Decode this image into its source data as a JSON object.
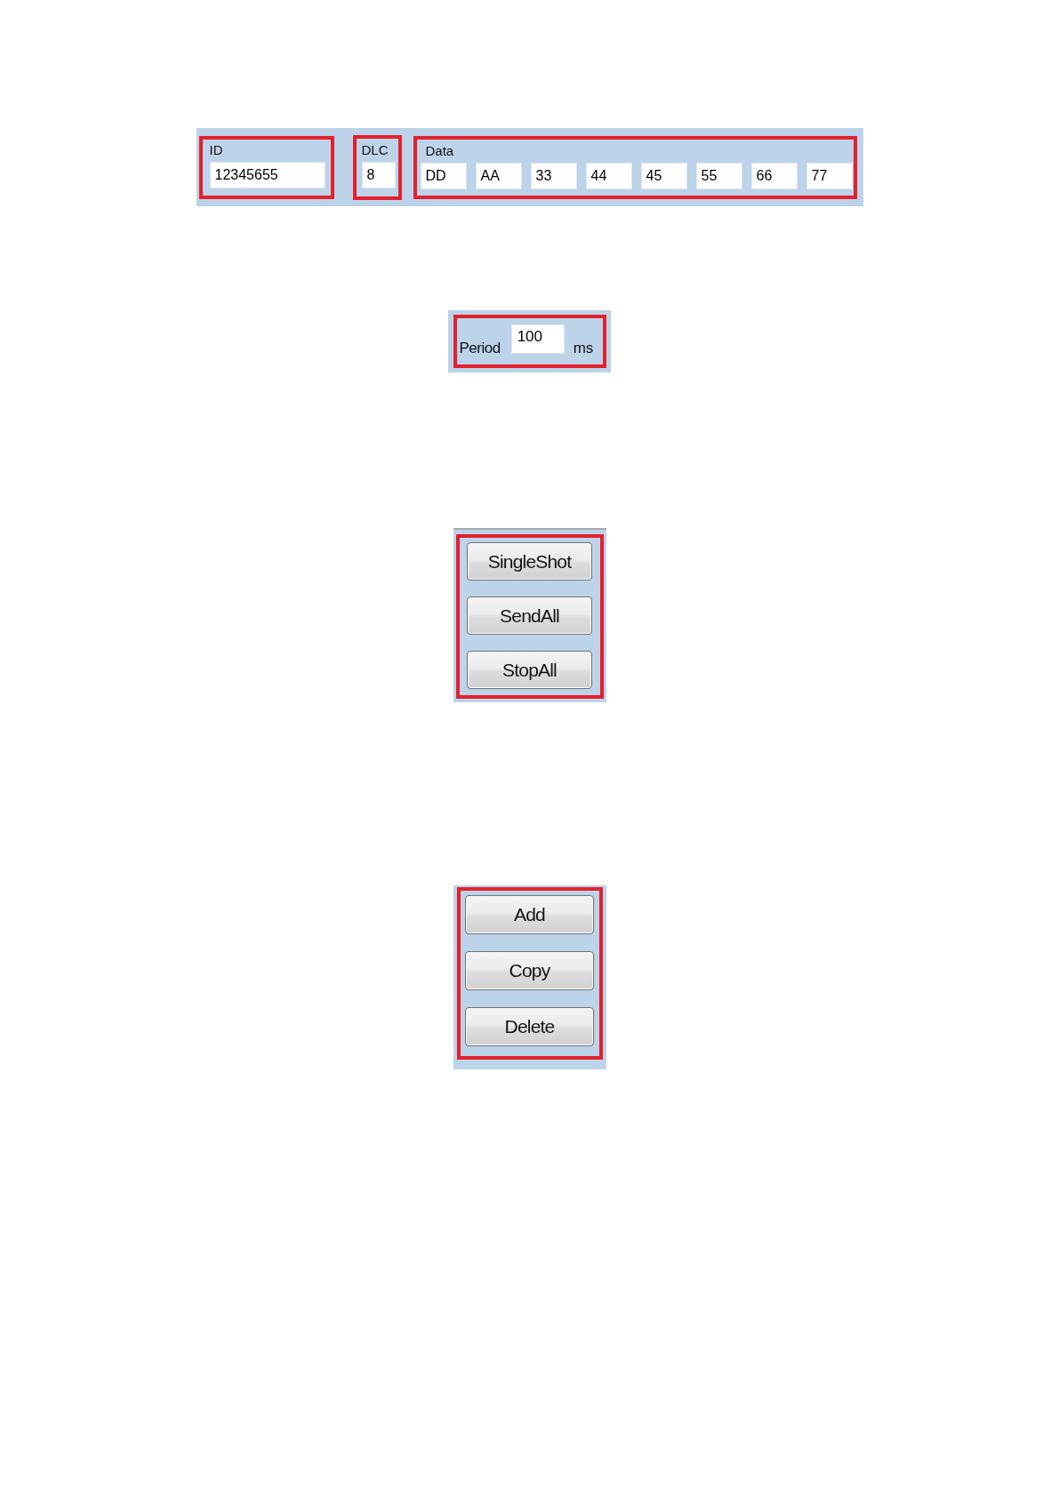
{
  "message": {
    "id": {
      "label": "ID",
      "value": "12345655"
    },
    "dlc": {
      "label": "DLC",
      "value": "8"
    },
    "data": {
      "label": "Data",
      "bytes": [
        "DD",
        "AA",
        "33",
        "44",
        "45",
        "55",
        "66",
        "77"
      ]
    }
  },
  "period": {
    "label": "Period",
    "value": "100",
    "unit": "ms"
  },
  "send_buttons": [
    "SingleShot",
    "SendAll",
    "StopAll"
  ],
  "edit_buttons": [
    "Add",
    "Copy",
    "Delete"
  ]
}
